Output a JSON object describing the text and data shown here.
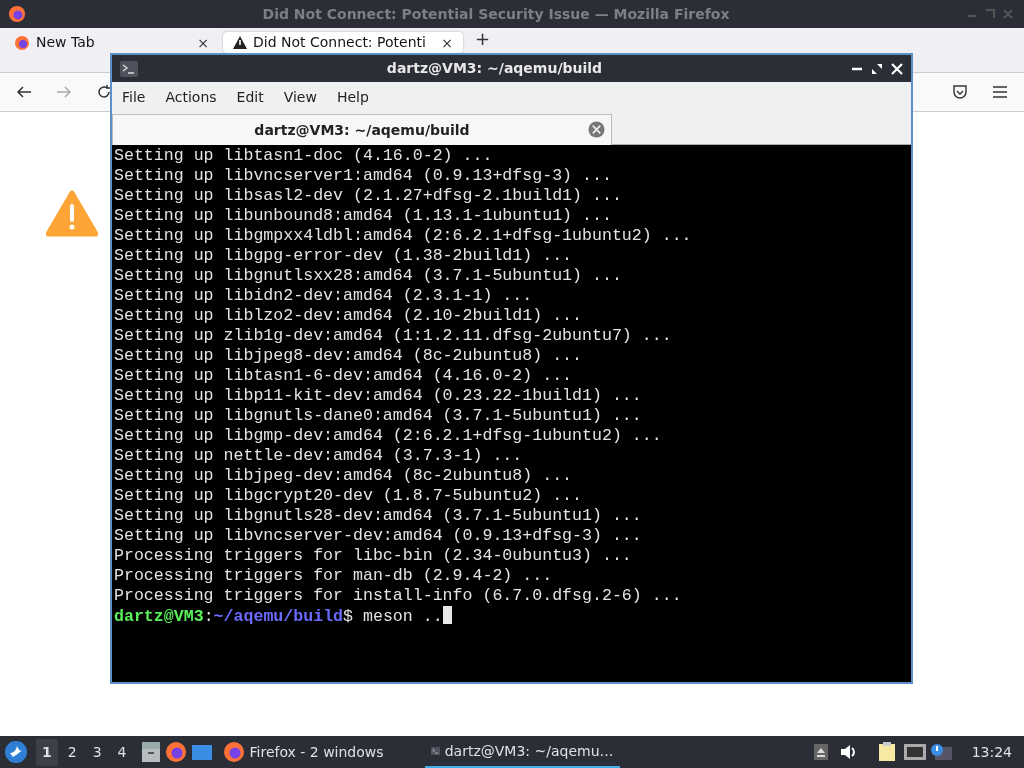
{
  "firefox": {
    "title": "Did Not Connect: Potential Security Issue — Mozilla Firefox",
    "tabs": [
      {
        "label": "New Tab",
        "selected": false,
        "close": "×"
      },
      {
        "label": "Did Not Connect: Potenti",
        "selected": true,
        "close": "×"
      }
    ],
    "new_tab": "+"
  },
  "terminal": {
    "title": "dartz@VM3: ~/aqemu/build",
    "menu": [
      "File",
      "Actions",
      "Edit",
      "View",
      "Help"
    ],
    "tabs": [
      {
        "label": "dartz@VM3: ~/aqemu/build",
        "selected": true
      }
    ],
    "lines": [
      "Setting up libtasn1-doc (4.16.0-2) ...",
      "Setting up libvncserver1:amd64 (0.9.13+dfsg-3) ...",
      "Setting up libsasl2-dev (2.1.27+dfsg-2.1build1) ...",
      "Setting up libunbound8:amd64 (1.13.1-1ubuntu1) ...",
      "Setting up libgmpxx4ldbl:amd64 (2:6.2.1+dfsg-1ubuntu2) ...",
      "Setting up libgpg-error-dev (1.38-2build1) ...",
      "Setting up libgnutlsxx28:amd64 (3.7.1-5ubuntu1) ...",
      "Setting up libidn2-dev:amd64 (2.3.1-1) ...",
      "Setting up liblzo2-dev:amd64 (2.10-2build1) ...",
      "Setting up zlib1g-dev:amd64 (1:1.2.11.dfsg-2ubuntu7) ...",
      "Setting up libjpeg8-dev:amd64 (8c-2ubuntu8) ...",
      "Setting up libtasn1-6-dev:amd64 (4.16.0-2) ...",
      "Setting up libp11-kit-dev:amd64 (0.23.22-1build1) ...",
      "Setting up libgnutls-dane0:amd64 (3.7.1-5ubuntu1) ...",
      "Setting up libgmp-dev:amd64 (2:6.2.1+dfsg-1ubuntu2) ...",
      "Setting up nettle-dev:amd64 (3.7.3-1) ...",
      "Setting up libjpeg-dev:amd64 (8c-2ubuntu8) ...",
      "Setting up libgcrypt20-dev (1.8.7-5ubuntu2) ...",
      "Setting up libgnutls28-dev:amd64 (3.7.1-5ubuntu1) ...",
      "Setting up libvncserver-dev:amd64 (0.9.13+dfsg-3) ...",
      "Processing triggers for libc-bin (2.34-0ubuntu3) ...",
      "Processing triggers for man-db (2.9.4-2) ...",
      "Processing triggers for install-info (6.7.0.dfsg.2-6) ..."
    ],
    "prompt": {
      "user_host": "dartz@VM3",
      "separator": ":",
      "path": "~/aqemu/build",
      "symbol": "$",
      "command": "meson .."
    }
  },
  "taskbar": {
    "workspaces": [
      {
        "label": "1",
        "selected": true
      },
      {
        "label": "2",
        "selected": false
      },
      {
        "label": "3",
        "selected": false
      },
      {
        "label": "4",
        "selected": false
      }
    ],
    "tasks": [
      {
        "label": "Firefox - 2 windows",
        "selected": false,
        "kind": "firefox"
      },
      {
        "label": "dartz@VM3: ~/aqemu…",
        "selected": true,
        "kind": "terminal"
      }
    ],
    "clock": "13:24"
  }
}
